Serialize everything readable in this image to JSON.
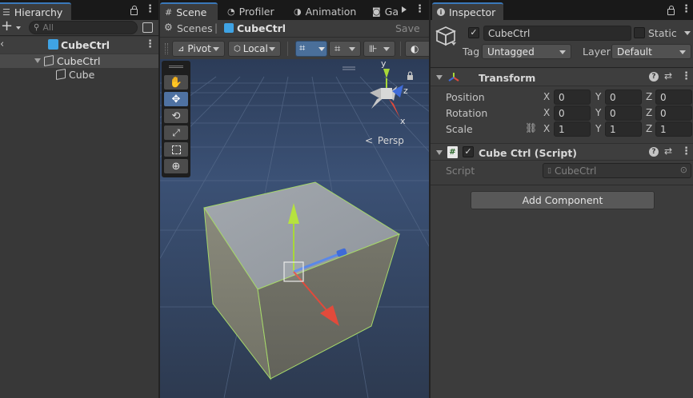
{
  "hierarchy": {
    "tab_label": "Hierarchy",
    "search_placeholder": "All",
    "scene_name": "CubeCtrl",
    "items": [
      {
        "label": "CubeCtrl"
      },
      {
        "label": "Cube"
      }
    ]
  },
  "scene": {
    "tabs": [
      {
        "label": "Scene"
      },
      {
        "label": "Profiler"
      },
      {
        "label": "Animation"
      },
      {
        "label": "Ga"
      }
    ],
    "breadcrumb_root": "Scenes",
    "breadcrumb_current": "CubeCtrl",
    "save_label": "Save",
    "pivot_label": "Pivot",
    "local_label": "Local",
    "persp_label": "Persp",
    "gizmo_axes": {
      "y": "y",
      "z": "z",
      "x": "x"
    }
  },
  "inspector": {
    "tab_label": "Inspector",
    "object_name": "CubeCtrl",
    "static_label": "Static",
    "tag_label": "Tag",
    "tag_value": "Untagged",
    "layer_label": "Layer",
    "layer_value": "Default",
    "transform": {
      "title": "Transform",
      "rows": [
        {
          "label": "Position",
          "x": "0",
          "y": "0",
          "z": "0"
        },
        {
          "label": "Rotation",
          "x": "0",
          "y": "0",
          "z": "0"
        },
        {
          "label": "Scale",
          "x": "1",
          "y": "1",
          "z": "1"
        }
      ]
    },
    "script_component": {
      "title": "Cube Ctrl (Script)",
      "script_label": "Script",
      "script_value": "CubeCtrl"
    },
    "add_component_label": "Add Component"
  },
  "colors": {
    "accent": "#3a79bb",
    "panel": "#383838",
    "scene_sky": "#3d5478",
    "ground": "#2f3b52",
    "axis_x": "#e24a3b",
    "axis_y": "#a8d838",
    "axis_z": "#3f6bd8"
  }
}
